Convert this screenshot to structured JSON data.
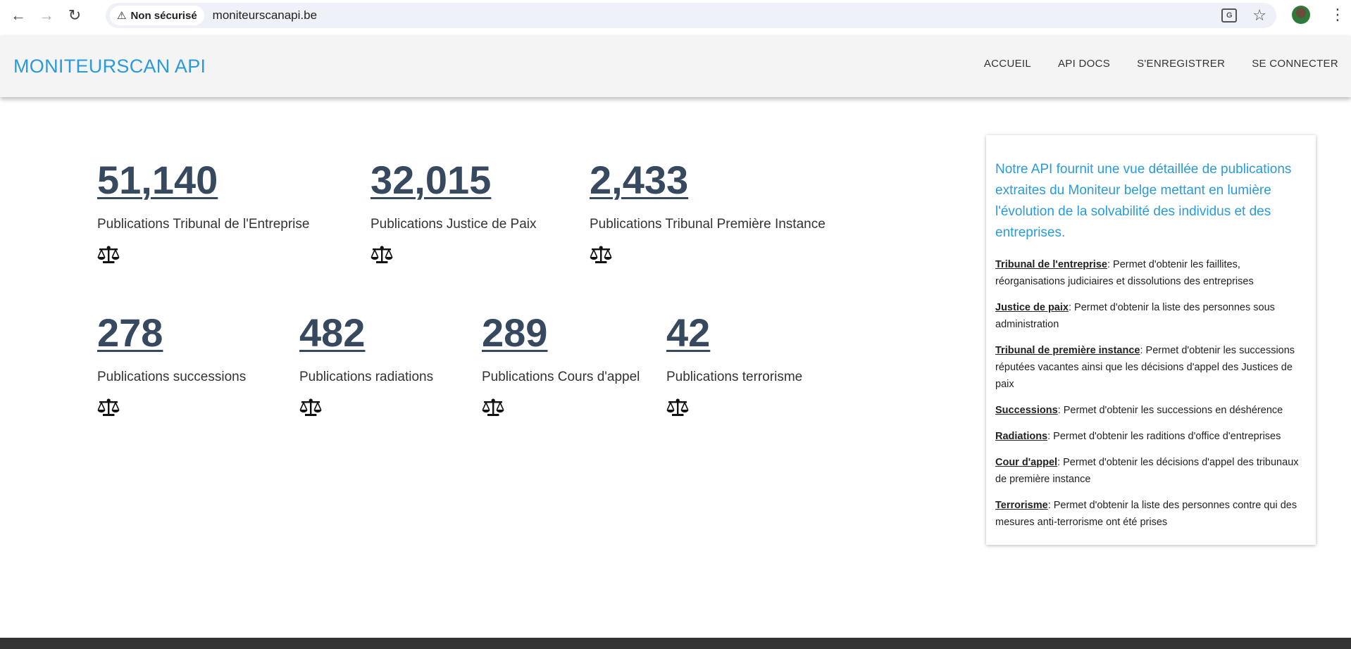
{
  "browser": {
    "security_label": "Non sécurisé",
    "url": "moniteurscanapi.be"
  },
  "header": {
    "brand": "MONITEURSCAN API",
    "nav": [
      "ACCUEIL",
      "API DOCS",
      "S'ENREGISTRER",
      "SE CONNECTER"
    ]
  },
  "stats": [
    {
      "value": "51,140",
      "label": "Publications Tribunal de l'Entreprise"
    },
    {
      "value": "32,015",
      "label": "Publications Justice de Paix"
    },
    {
      "value": "2,433",
      "label": "Publications Tribunal Première Instance"
    },
    {
      "value": "278",
      "label": "Publications successions"
    },
    {
      "value": "482",
      "label": "Publications radiations"
    },
    {
      "value": "289",
      "label": "Publications Cours d'appel"
    },
    {
      "value": "42",
      "label": "Publications terrorisme"
    }
  ],
  "info": {
    "intro": "Notre API fournit une vue détaillée de publications extraites du Moniteur belge mettant en lumière l'évolution de la solvabilité des individus et des entreprises.",
    "items": [
      {
        "term": "Tribunal de l'entreprise",
        "text": ": Permet d'obtenir les faillites, réorganisations judiciaires et dissolutions des entreprises"
      },
      {
        "term": "Justice de paix",
        "text": ": Permet d'obtenir la liste des personnes sous administration"
      },
      {
        "term": "Tribunal de première instance",
        "text": ": Permet d'obtenir les successions réputées vacantes ainsi que les décisions d'appel des Justices de paix"
      },
      {
        "term": "Successions",
        "text": ": Permet d'obtenir les successions en déshérence"
      },
      {
        "term": "Radiations",
        "text": ": Permet d'obtenir les raditions d'office d'entreprises"
      },
      {
        "term": "Cour d'appel",
        "text": ": Permet d'obtenir les décisions d'appel des tribunaux de première instance"
      },
      {
        "term": "Terrorisme",
        "text": ": Permet d'obtenir la liste des personnes contre qui des mesures anti-terrorisme ont été prises"
      }
    ]
  },
  "icons": {
    "scale": "balance-scale-icon",
    "back": "arrow-left-icon",
    "forward": "arrow-right-icon",
    "reload": "reload-icon",
    "warning": "warning-triangle-icon",
    "translate": "translate-icon",
    "bookmark": "star-icon",
    "menu": "kebab-menu-icon"
  },
  "colors": {
    "brand": "#2a9bd8",
    "stat_number": "#36495e",
    "header_bg": "#f4f4f4",
    "footer": "#333333"
  }
}
